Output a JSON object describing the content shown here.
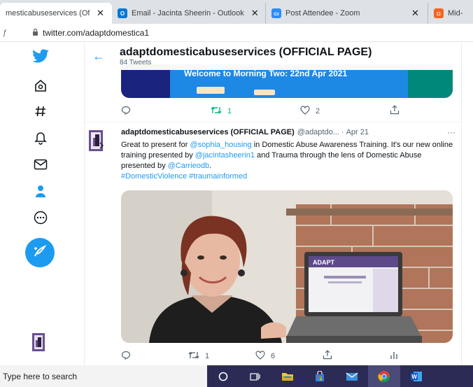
{
  "browser": {
    "tabs": [
      {
        "title": "mesticabuseservices (Of",
        "close": "✕",
        "active": true,
        "favicon": "none",
        "color": "#1d9bf0"
      },
      {
        "title": "Email - Jacinta Sheerin - Outlook",
        "close": "✕",
        "active": false,
        "favicon": "outlook-icon",
        "color": "#0078d4"
      },
      {
        "title": "Post Attendee - Zoom",
        "close": "✕",
        "active": false,
        "favicon": "zoom-icon",
        "color": "#2d8cff"
      },
      {
        "title": "Mid-",
        "close": "",
        "active": false,
        "favicon": "orange-app-icon",
        "color": "#f26522"
      }
    ],
    "address": {
      "back_stub": "ƒ",
      "url": "twitter.com/adaptdomestica1"
    }
  },
  "nav": {
    "icons": [
      "twitter-bird-icon",
      "home-icon",
      "explore-hashtag-icon",
      "notifications-bell-icon",
      "messages-envelope-icon",
      "profile-person-icon",
      "more-circle-icon",
      "compose-tweet-icon"
    ],
    "accent": "#1d9bf0"
  },
  "header": {
    "back": "←",
    "name": "adaptdomesticabuseservices (OFFICIAL PAGE)",
    "tweet_count": "84 Tweets"
  },
  "tweet1": {
    "image_text": "Welcome to Morning Two: 22nd Apr 2021",
    "reply_count": "",
    "retweet_count": "1",
    "like_count": "2",
    "retweet_color": "#00ba7c"
  },
  "tweet2": {
    "name": "adaptdomesticabuseservices (OFFICIAL PAGE)",
    "handle": "@adaptdo...",
    "dot": "·",
    "date": "Apr 21",
    "more": "···",
    "text_1": "Great to present for ",
    "mention_1": "@sophia_housing",
    "text_2": " in Domestic Abuse Awareness Training. It's our new online training presented by ",
    "mention_2": "@jacintasheerin1",
    "text_3": " and Trauma through the lens of Domestic Abuse presented by ",
    "mention_3": "@Carrieodb",
    "text_4": ".",
    "hashtag_1": "#DomesticViolence",
    "hashtag_2": "#traumainformed",
    "image_laptop_text": "ADAPT",
    "retweet_count": "1",
    "like_count": "6"
  },
  "taskbar": {
    "search_placeholder": "Type here to search",
    "icons": [
      "cortana-circle-icon",
      "task-view-icon",
      "file-explorer-icon",
      "store-bag-icon",
      "mail-icon",
      "chrome-icon",
      "word-icon"
    ],
    "active": "chrome-icon"
  }
}
